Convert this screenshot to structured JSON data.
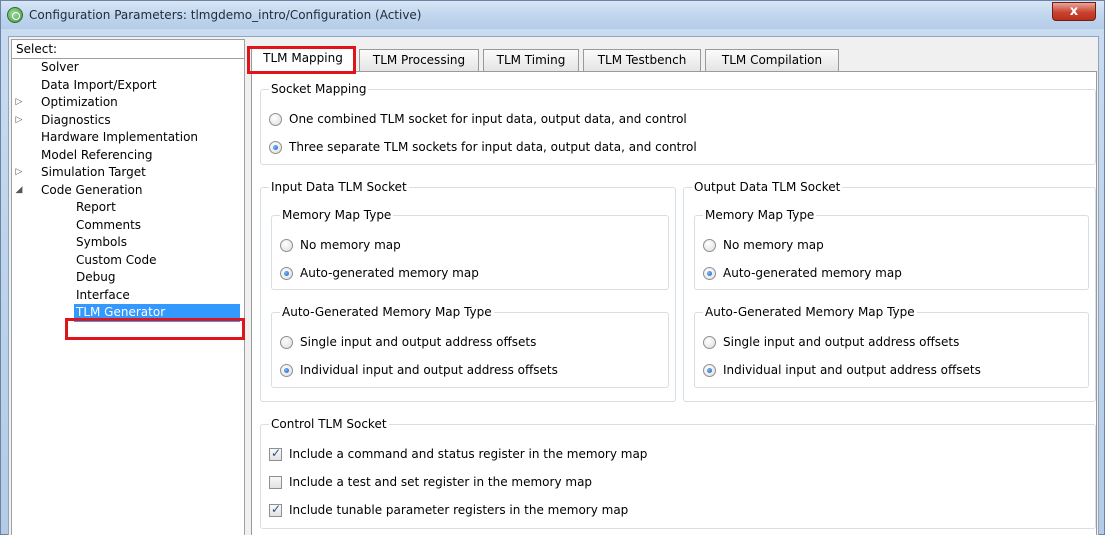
{
  "window": {
    "title": "Configuration Parameters: tlmgdemo_intro/Configuration (Active)",
    "close_label": "x"
  },
  "left_pane": {
    "header": "Select:",
    "tree": [
      {
        "label": "Solver",
        "level": 0,
        "arrow": ""
      },
      {
        "label": "Data Import/Export",
        "level": 0,
        "arrow": ""
      },
      {
        "label": "Optimization",
        "level": 0,
        "arrow": "▷"
      },
      {
        "label": "Diagnostics",
        "level": 0,
        "arrow": "▷"
      },
      {
        "label": "Hardware Implementation",
        "level": 0,
        "arrow": ""
      },
      {
        "label": "Model Referencing",
        "level": 0,
        "arrow": ""
      },
      {
        "label": "Simulation Target",
        "level": 0,
        "arrow": "▷"
      },
      {
        "label": "Code Generation",
        "level": 0,
        "arrow": "◢"
      },
      {
        "label": "Report",
        "level": 1,
        "arrow": ""
      },
      {
        "label": "Comments",
        "level": 1,
        "arrow": ""
      },
      {
        "label": "Symbols",
        "level": 1,
        "arrow": ""
      },
      {
        "label": "Custom Code",
        "level": 1,
        "arrow": ""
      },
      {
        "label": "Debug",
        "level": 1,
        "arrow": ""
      },
      {
        "label": "Interface",
        "level": 1,
        "arrow": ""
      },
      {
        "label": "TLM Generator",
        "level": 1,
        "arrow": "",
        "selected": true
      }
    ]
  },
  "tabs": [
    {
      "label": "TLM Mapping",
      "active": true
    },
    {
      "label": "TLM Processing"
    },
    {
      "label": "TLM Timing"
    },
    {
      "label": "TLM Testbench"
    },
    {
      "label": "TLM Compilation"
    }
  ],
  "socket_mapping": {
    "legend": "Socket Mapping",
    "options": [
      {
        "label": "One combined TLM socket for input data, output data, and control",
        "checked": false
      },
      {
        "label": "Three separate TLM sockets for input data, output data, and control",
        "checked": true
      }
    ]
  },
  "input_socket": {
    "legend": "Input Data TLM Socket",
    "memory_map_type": {
      "legend": "Memory Map Type",
      "options": [
        {
          "label": "No memory map",
          "checked": false
        },
        {
          "label": "Auto-generated memory map",
          "checked": true
        }
      ]
    },
    "auto_map_type": {
      "legend": "Auto-Generated Memory Map Type",
      "options": [
        {
          "label": "Single input and output address offsets",
          "checked": false
        },
        {
          "label": "Individual input and output address offsets",
          "checked": true
        }
      ]
    }
  },
  "output_socket": {
    "legend": "Output Data TLM Socket",
    "memory_map_type": {
      "legend": "Memory Map Type",
      "options": [
        {
          "label": "No memory map",
          "checked": false
        },
        {
          "label": "Auto-generated memory map",
          "checked": true
        }
      ]
    },
    "auto_map_type": {
      "legend": "Auto-Generated Memory Map Type",
      "options": [
        {
          "label": "Single input and output address offsets",
          "checked": false
        },
        {
          "label": "Individual input and output address offsets",
          "checked": true
        }
      ]
    }
  },
  "control_socket": {
    "legend": "Control TLM Socket",
    "options": [
      {
        "label": "Include a command and status register in the memory map",
        "checked": true
      },
      {
        "label": "Include a test and set register in the memory map",
        "checked": false
      },
      {
        "label": "Include tunable parameter registers in the memory map",
        "checked": true
      }
    ]
  },
  "colors": {
    "selection": "#3399ff",
    "highlight_outline": "#e0151c"
  }
}
